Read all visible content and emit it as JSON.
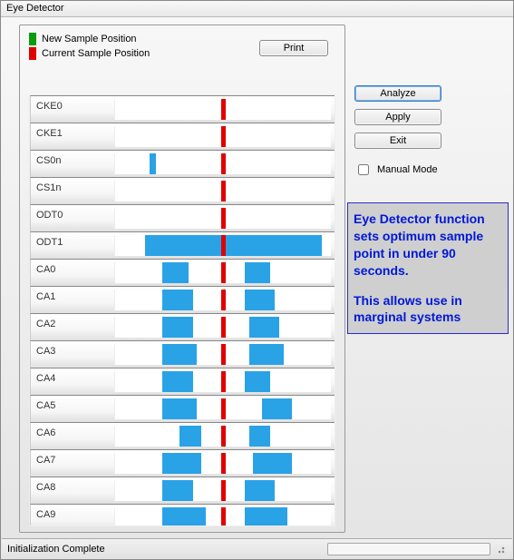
{
  "window": {
    "title": "Eye Detector"
  },
  "legend": {
    "new_label": "New Sample Position",
    "current_label": "Current Sample Position"
  },
  "buttons": {
    "print": "Print",
    "analyze": "Analyze",
    "apply": "Apply",
    "exit": "Exit",
    "manual_mode": "Manual Mode"
  },
  "manual_mode_checked": false,
  "annotation": {
    "line1": "Eye Detector function sets optimum sample point in under 90 seconds.",
    "line2": "This allows use in marginal systems"
  },
  "status": {
    "text": "Initialization Complete"
  },
  "chart_data": {
    "type": "table",
    "title": "Eye Detector sample-position lanes",
    "x_range_pct": [
      0,
      100
    ],
    "center_pct": 50,
    "colors": {
      "segment": "#2aa2e6",
      "current_marker": "#e00000",
      "new_marker": "#0a9c0a"
    },
    "signals": [
      {
        "name": "CKE0",
        "segments": [],
        "current_pos_pct": 50
      },
      {
        "name": "CKE1",
        "segments": [],
        "current_pos_pct": 50
      },
      {
        "name": "CS0n",
        "segments": [
          [
            16,
            19
          ]
        ],
        "current_pos_pct": 50
      },
      {
        "name": "CS1n",
        "segments": [],
        "current_pos_pct": 50
      },
      {
        "name": "ODT0",
        "segments": [],
        "current_pos_pct": 50
      },
      {
        "name": "ODT1",
        "segments": [
          [
            14,
            96
          ]
        ],
        "current_pos_pct": 50
      },
      {
        "name": "CA0",
        "segments": [
          [
            22,
            34
          ],
          [
            60,
            72
          ]
        ],
        "current_pos_pct": 50
      },
      {
        "name": "CA1",
        "segments": [
          [
            22,
            36
          ],
          [
            60,
            74
          ]
        ],
        "current_pos_pct": 50
      },
      {
        "name": "CA2",
        "segments": [
          [
            22,
            36
          ],
          [
            62,
            76
          ]
        ],
        "current_pos_pct": 50
      },
      {
        "name": "CA3",
        "segments": [
          [
            22,
            38
          ],
          [
            62,
            78
          ]
        ],
        "current_pos_pct": 50
      },
      {
        "name": "CA4",
        "segments": [
          [
            22,
            36
          ],
          [
            60,
            72
          ]
        ],
        "current_pos_pct": 50
      },
      {
        "name": "CA5",
        "segments": [
          [
            22,
            38
          ],
          [
            68,
            82
          ]
        ],
        "current_pos_pct": 50
      },
      {
        "name": "CA6",
        "segments": [
          [
            30,
            40
          ],
          [
            62,
            72
          ]
        ],
        "current_pos_pct": 50
      },
      {
        "name": "CA7",
        "segments": [
          [
            22,
            40
          ],
          [
            64,
            82
          ]
        ],
        "current_pos_pct": 50
      },
      {
        "name": "CA8",
        "segments": [
          [
            22,
            36
          ],
          [
            60,
            74
          ]
        ],
        "current_pos_pct": 50
      },
      {
        "name": "CA9",
        "segments": [
          [
            22,
            42
          ],
          [
            60,
            80
          ]
        ],
        "current_pos_pct": 50
      }
    ]
  }
}
